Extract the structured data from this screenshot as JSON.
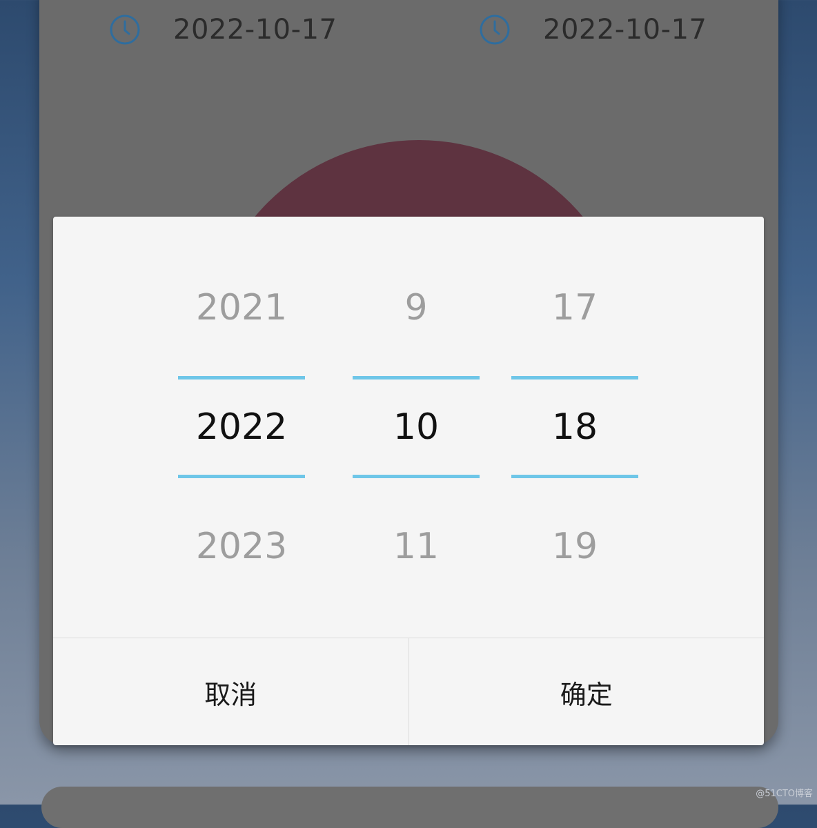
{
  "colors": {
    "accent_line": "#6ec6e8",
    "icon_blue": "#2f6d9e",
    "selected_text": "#111111",
    "unselected_text": "#9d9d9d",
    "dome": "#5e3340"
  },
  "background_card": {
    "start_date": {
      "icon": "clock-icon",
      "value": "2022-10-17"
    },
    "end_date": {
      "icon": "clock-icon",
      "value": "2022-10-17"
    }
  },
  "date_picker": {
    "year": {
      "prev": "2021",
      "current": "2022",
      "next": "2023"
    },
    "month": {
      "prev": "9",
      "current": "10",
      "next": "11"
    },
    "day": {
      "prev": "17",
      "current": "18",
      "next": "19"
    },
    "cancel_label": "取消",
    "confirm_label": "确定"
  },
  "watermark": "@51CTO博客"
}
